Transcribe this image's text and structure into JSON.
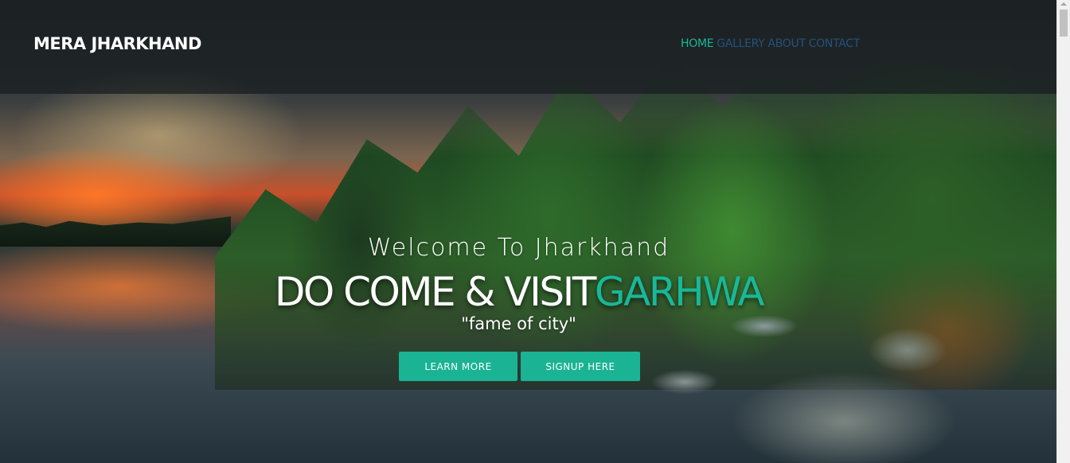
{
  "brand": {
    "title": "MERA JHARKHAND"
  },
  "nav": {
    "items": [
      {
        "label": "HOME",
        "active": true
      },
      {
        "label": "GALLERY",
        "active": false
      },
      {
        "label": "ABOUT",
        "active": false
      },
      {
        "label": "CONTACT",
        "active": false
      }
    ]
  },
  "hero": {
    "welcome": "Welcome To Jharkhand",
    "headline_main": "DO COME & VISIT",
    "headline_accent": "GARHWA",
    "tagline": "\"fame of city\"",
    "buttons": {
      "learn_more": "LEARN MORE",
      "signup": "SIGNUP HERE"
    }
  },
  "colors": {
    "accent": "#18b899",
    "button": "#1ab394",
    "nav_inactive": "#23527c",
    "navbar_bg": "rgba(22,28,30,0.72)"
  },
  "icons": [
    "scroll-up-arrow-icon"
  ]
}
